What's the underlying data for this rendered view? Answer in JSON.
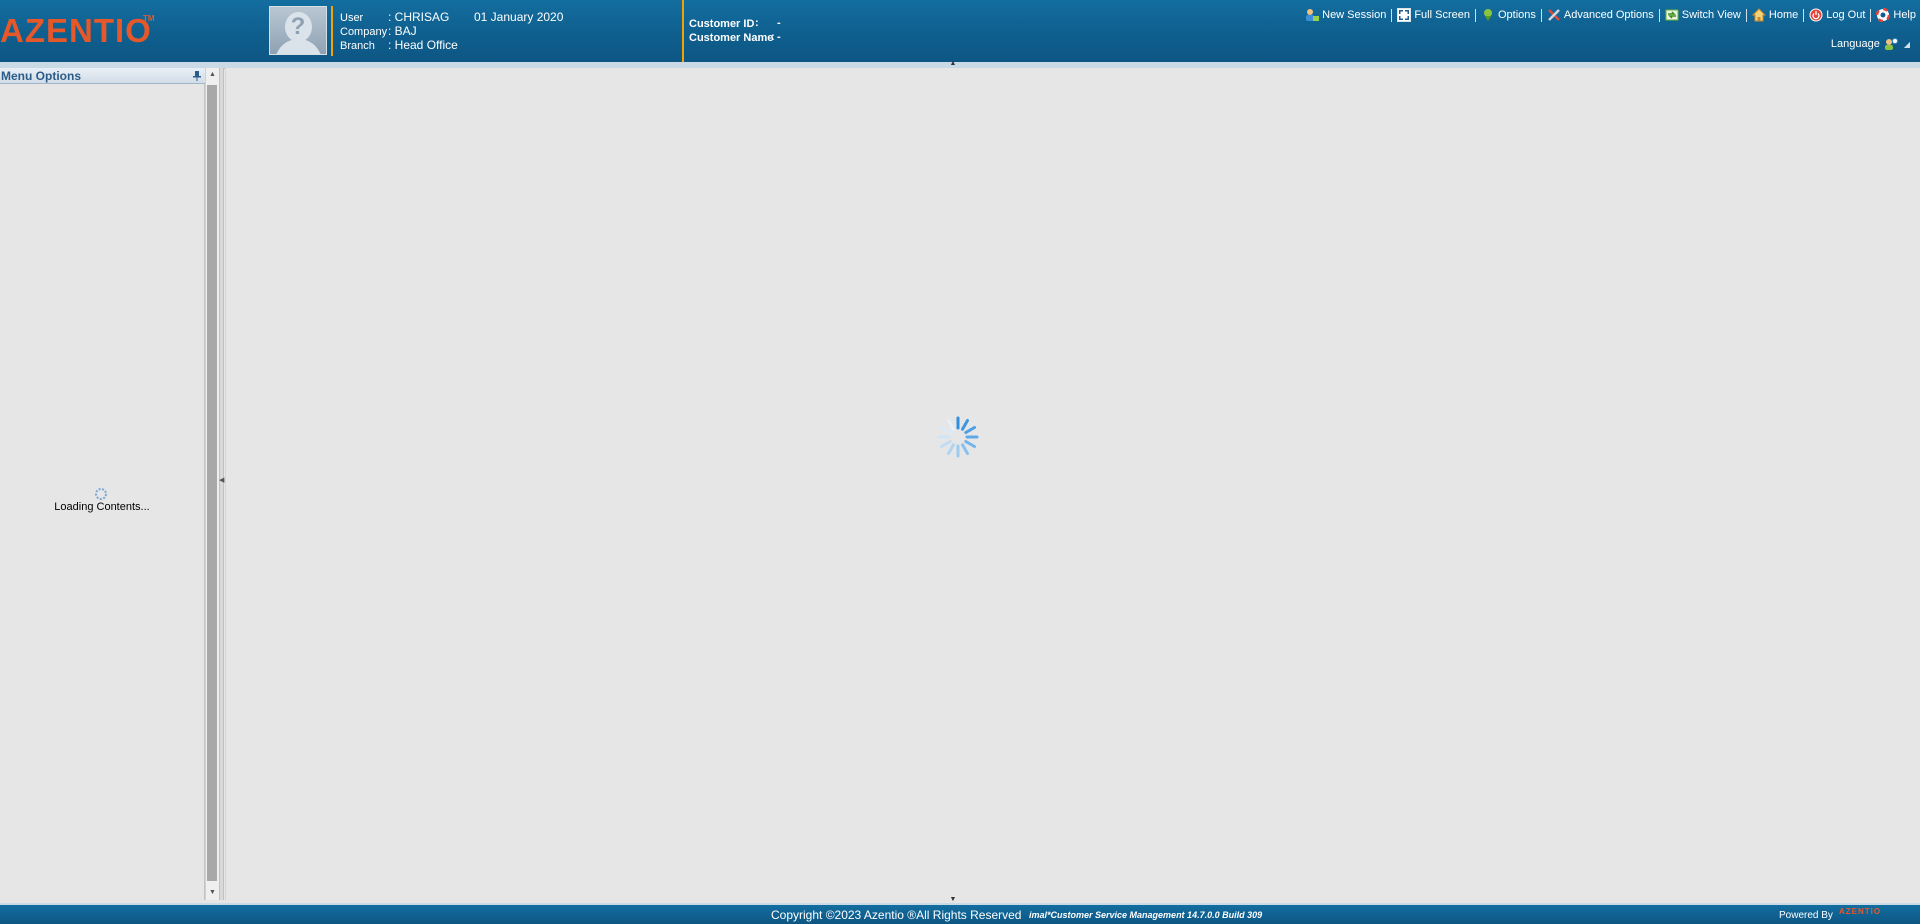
{
  "header": {
    "logo": "AZENTIO",
    "logo_tm": "TM",
    "user": {
      "user_label": "User",
      "user_value": ": CHRISAG",
      "date": "01 January 2020",
      "company_label": "Company",
      "company_value": ": BAJ",
      "branch_label": "Branch",
      "branch_value": ": Head Office",
      "avatar_glyph": "?"
    },
    "customer": {
      "id_label": "Customer ID",
      "id_sep": ":",
      "id_value": "-",
      "name_label": "Customer Name",
      "name_sep": ":",
      "name_value": "-"
    },
    "toolbar": [
      {
        "label": "New Session",
        "icon": "new-session-icon"
      },
      {
        "label": "Full Screen",
        "icon": "full-screen-icon"
      },
      {
        "label": "Options",
        "icon": "options-icon"
      },
      {
        "label": "Advanced Options",
        "icon": "advanced-options-icon"
      },
      {
        "label": "Switch View",
        "icon": "switch-view-icon"
      },
      {
        "label": "Home",
        "icon": "home-icon"
      },
      {
        "label": "Log Out",
        "icon": "log-out-icon"
      },
      {
        "label": "Help",
        "icon": "help-icon"
      }
    ],
    "language": {
      "label": "Language",
      "icon": "language-icon"
    }
  },
  "sidebar": {
    "title": "Menu Options",
    "loading_text": "Loading Contents..."
  },
  "footer": {
    "copyright": "Copyright ©2023 Azentio ®All Rights Reserved",
    "version": "imal*Customer Service Management 14.7.0.0 Build 309",
    "powered_by": "Powered By",
    "powered_logo": "AZENTIO"
  },
  "colors": {
    "brand_orange": "#e5582a",
    "header_blue": "#0f5f8e",
    "accent_yellow": "#f2a300",
    "panel_title_text": "#2a5c8a",
    "background": "#e6e6e6"
  }
}
